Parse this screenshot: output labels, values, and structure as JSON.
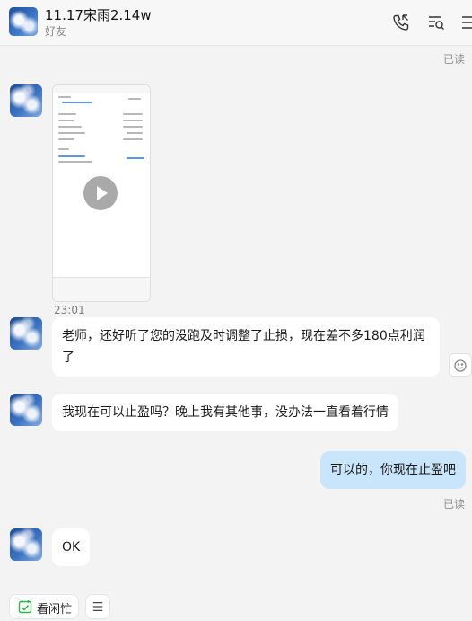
{
  "header": {
    "title": "11.17宋雨2.14w",
    "subtitle": "好友",
    "icons": [
      "call-icon",
      "search-history-icon",
      "more-icon"
    ]
  },
  "chat": {
    "read_label": "已读",
    "video_time": "23:01",
    "messages": [
      {
        "sender": "contact",
        "type": "video"
      },
      {
        "sender": "contact",
        "type": "text",
        "line1": "老师，还好听了您的没跑及时调整了止损，现在差不多180点利润",
        "line2": "了"
      },
      {
        "sender": "contact",
        "type": "text",
        "text": "我现在可以止盈吗？晚上我有其他事，没办法一直看着行情"
      },
      {
        "sender": "me",
        "type": "text",
        "text": "可以的，你现在止盈吧"
      },
      {
        "sender": "contact",
        "type": "text",
        "text": "OK"
      }
    ]
  },
  "bottom": {
    "busy_label": "看闲忙",
    "accent": "#2fb34a"
  }
}
